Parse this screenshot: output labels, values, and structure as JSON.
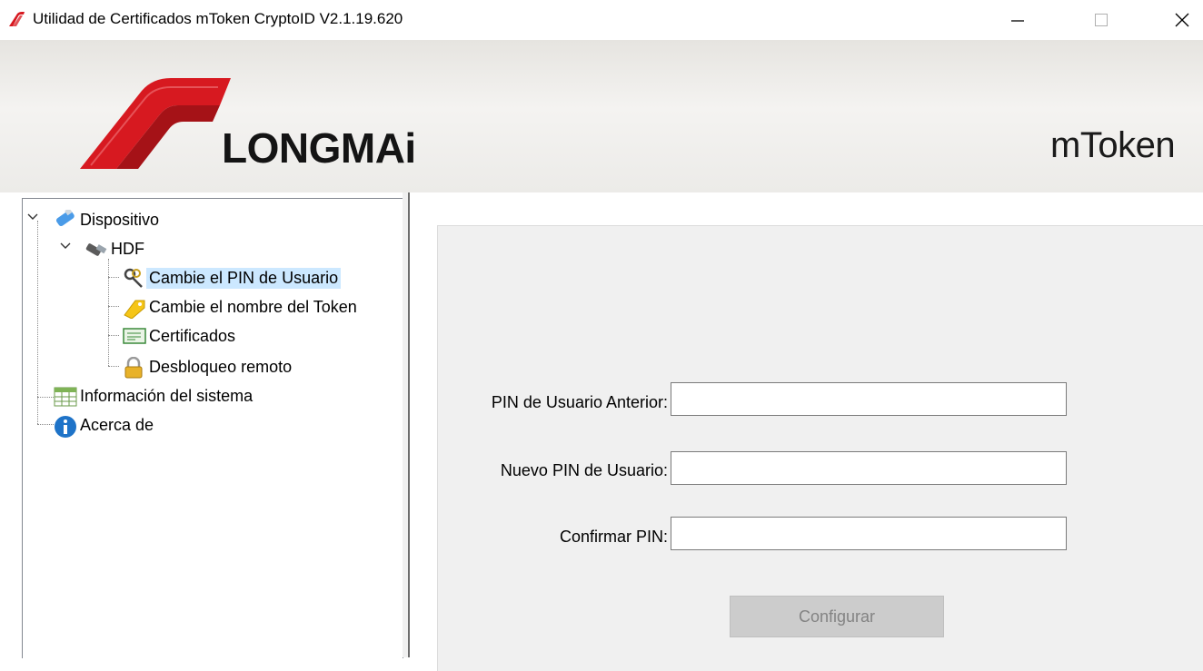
{
  "window": {
    "title": "Utilidad de Certificados mToken CryptoID  V2.1.19.620"
  },
  "banner": {
    "brand": "LONGMAi",
    "product": "mToken"
  },
  "tree": {
    "items": [
      {
        "label": "Dispositivo",
        "icon": "usb-token-icon"
      },
      {
        "label": "HDF",
        "icon": "usb-reader-icon"
      },
      {
        "label": "Cambie el PIN de Usuario",
        "icon": "keys-icon",
        "selected": true
      },
      {
        "label": "Cambie el nombre del Token",
        "icon": "tag-icon"
      },
      {
        "label": "Certificados",
        "icon": "certificate-icon"
      },
      {
        "label": "Desbloqueo remoto",
        "icon": "lock-icon"
      },
      {
        "label": "Información del sistema",
        "icon": "table-icon"
      },
      {
        "label": "Acerca de",
        "icon": "info-icon"
      }
    ]
  },
  "form": {
    "old_pin_label": "PIN de Usuario Anterior:",
    "new_pin_label": "Nuevo PIN de Usuario:",
    "confirm_pin_label": "Confirmar PIN:",
    "old_pin_value": "",
    "new_pin_value": "",
    "confirm_pin_value": "",
    "configure_button": "Configurar"
  },
  "colors": {
    "accent_red": "#d71920",
    "selection": "#cce8ff",
    "disabled_button": "#cccccc"
  }
}
